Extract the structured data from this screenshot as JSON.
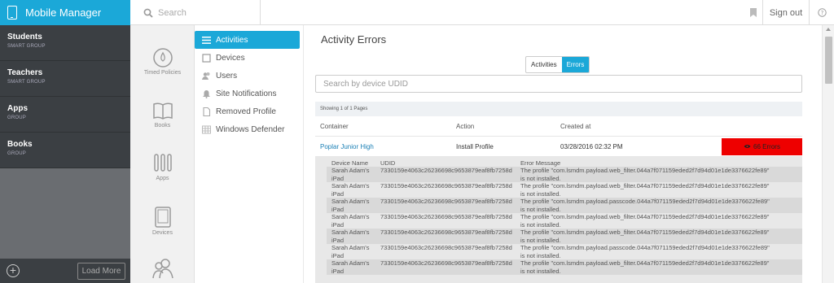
{
  "app": {
    "title": "Mobile Manager"
  },
  "header": {
    "search_placeholder": "Search",
    "signout_label": "Sign out"
  },
  "groups": {
    "items": [
      {
        "name": "Students",
        "type": "SMART GROUP"
      },
      {
        "name": "Teachers",
        "type": "SMART GROUP"
      },
      {
        "name": "Apps",
        "type": "GROUP"
      },
      {
        "name": "Books",
        "type": "GROUP"
      }
    ],
    "load_more_label": "Load More"
  },
  "rail": {
    "items": [
      {
        "label": "Timed Policies",
        "icon": "timed-policies-icon"
      },
      {
        "label": "Books",
        "icon": "book-icon"
      },
      {
        "label": "Apps",
        "icon": "apps-icon"
      },
      {
        "label": "Devices",
        "icon": "tablet-icon"
      },
      {
        "label": "",
        "icon": "users-icon"
      }
    ]
  },
  "section_nav": {
    "items": [
      {
        "label": "Activities",
        "active": true
      },
      {
        "label": "Devices"
      },
      {
        "label": "Users"
      },
      {
        "label": "Site Notifications"
      },
      {
        "label": "Removed Profile"
      },
      {
        "label": "Windows Defender"
      }
    ]
  },
  "main": {
    "title": "Activity Errors",
    "toggle": {
      "activities": "Activities",
      "errors": "Errors",
      "selected": "Errors"
    },
    "udid_placeholder": "Search by device UDID",
    "showing": "Showing 1 of 1 Pages",
    "columns": {
      "container": "Container",
      "action": "Action",
      "created": "Created at"
    },
    "row": {
      "container": "Poplar Junior High",
      "action": "Install Profile",
      "created": "03/28/2016 02:32 PM",
      "errors_label": "66 Errors"
    },
    "error_columns": {
      "device": "Device Name",
      "udid": "UDID",
      "message": "Error Message"
    },
    "errors": [
      {
        "device_line1": "Sarah Adam's",
        "device_line2": "iPad",
        "udid": "7330159e4063c26236698c9653879eaf8fb7258d",
        "msg_line1": "The profile \"com.lsmdm.payload.web_filter.044a7f071159eded2f7d94d01e1de3376622fe89\"",
        "msg_line2": "is not installed."
      },
      {
        "device_line1": "Sarah Adam's",
        "device_line2": "iPad",
        "udid": "7330159e4063c26236698c9653879eaf8fb7258d",
        "msg_line1": "The profile \"com.lsmdm.payload.web_filter.044a7f071159eded2f7d94d01e1de3376622fe89\"",
        "msg_line2": "is not installed."
      },
      {
        "device_line1": "Sarah Adam's",
        "device_line2": "iPad",
        "udid": "7330159e4063c26236698c9653879eaf8fb7258d",
        "msg_line1": "The profile \"com.lsmdm.payload.passcode.044a7f071159eded2f7d94d01e1de3376622fe89\"",
        "msg_line2": "is not installed."
      },
      {
        "device_line1": "Sarah Adam's",
        "device_line2": "iPad",
        "udid": "7330159e4063c26236698c9653879eaf8fb7258d",
        "msg_line1": "The profile \"com.lsmdm.payload.web_filter.044a7f071159eded2f7d94d01e1de3376622fe89\"",
        "msg_line2": "is not installed."
      },
      {
        "device_line1": "Sarah Adam's",
        "device_line2": "iPad",
        "udid": "7330159e4063c26236698c9653879eaf8fb7258d",
        "msg_line1": "The profile \"com.lsmdm.payload.web_filter.044a7f071159eded2f7d94d01e1de3376622fe89\"",
        "msg_line2": "is not installed."
      },
      {
        "device_line1": "Sarah Adam's",
        "device_line2": "iPad",
        "udid": "7330159e4063c26236698c9653879eaf8fb7258d",
        "msg_line1": "The profile \"com.lsmdm.payload.passcode.044a7f071159eded2f7d94d01e1de3376622fe89\"",
        "msg_line2": "is not installed."
      },
      {
        "device_line1": "Sarah Adam's",
        "device_line2": "iPad",
        "udid": "7330159e4063c26236698c9653879eaf8fb7258d",
        "msg_line1": "The profile \"com.lsmdm.payload.web_filter.044a7f071159eded2f7d94d01e1de3376622fe89\"",
        "msg_line2": "is not installed."
      }
    ]
  },
  "colors": {
    "accent": "#1ba8d8",
    "sidebar": "#3b3f43",
    "error": "#ee0000"
  }
}
